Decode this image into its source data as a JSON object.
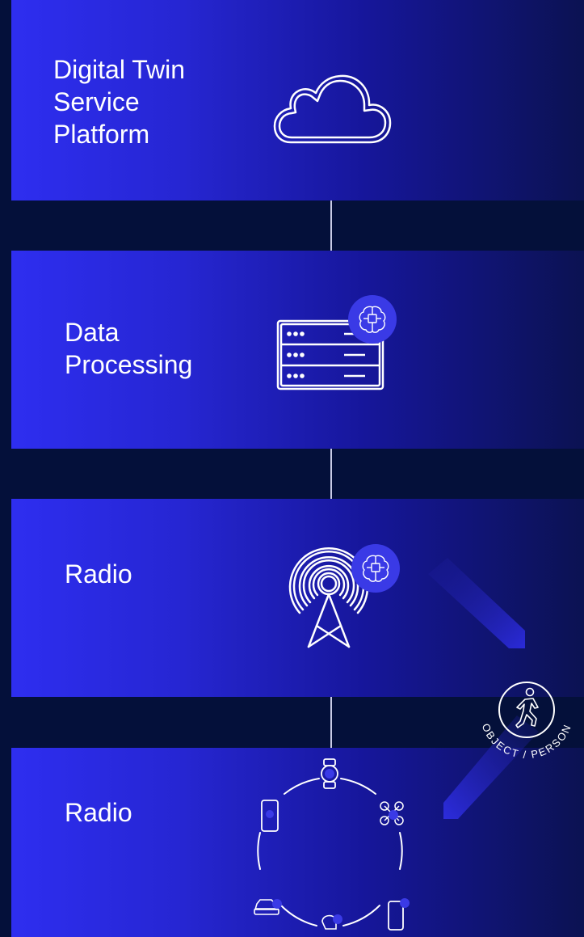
{
  "layers": [
    {
      "label_lines": [
        "Digital Twin",
        "Service",
        "Platform"
      ],
      "icon": "cloud-icon"
    },
    {
      "label_lines": [
        "Data",
        "Processing"
      ],
      "icon": "server-icon",
      "badge": "ai-brain-icon"
    },
    {
      "label_lines": [
        "Radio"
      ],
      "icon": "radio-tower-icon",
      "badge": "ai-brain-icon"
    },
    {
      "label_lines": [
        "Radio"
      ],
      "icon": "device-ring-icon"
    }
  ],
  "object_badge": {
    "text": "OBJECT / PERSON",
    "icon": "walking-person-icon"
  },
  "colors": {
    "background": "#04103a",
    "panel_start": "#2e2ef0",
    "panel_end": "#0b1252",
    "accent": "#3a3ae6",
    "line": "#c9cbe6"
  }
}
